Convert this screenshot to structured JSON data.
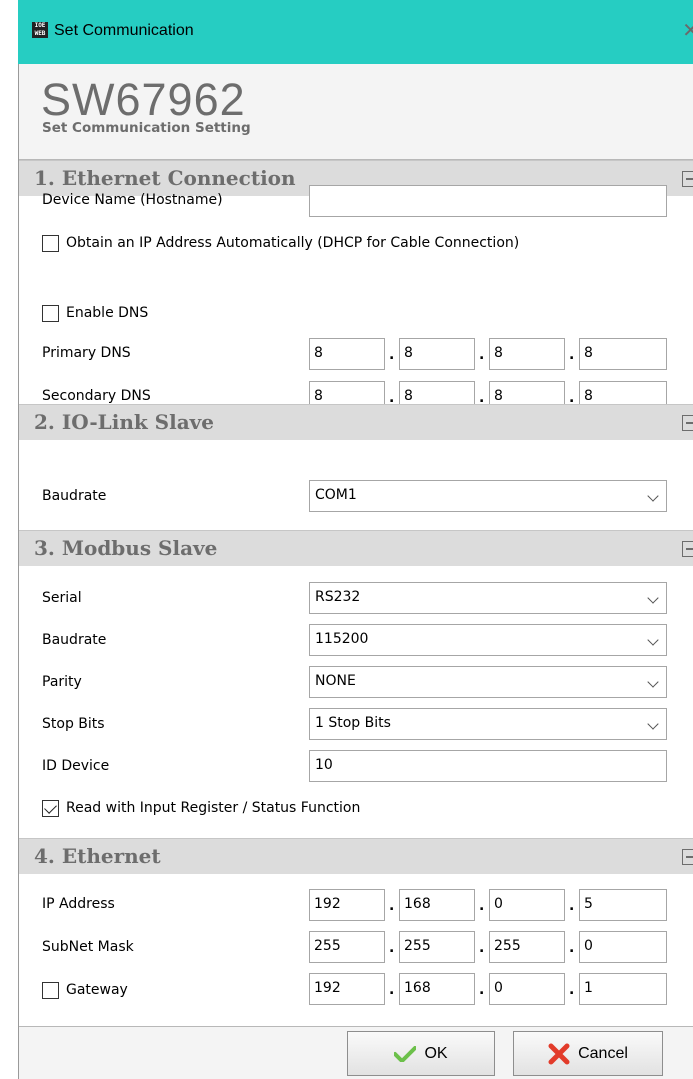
{
  "window": {
    "title": "Set Communication",
    "icon": "app-web-icon"
  },
  "header": {
    "code": "SW67962",
    "subtitle": "Set Communication Setting"
  },
  "ethernet_connection": {
    "title": "1. Ethernet Connection",
    "device_name_label": "Device Name (Hostname)",
    "device_name_value": "",
    "dhcp_label": "Obtain an IP Address Automatically (DHCP for Cable Connection)",
    "dhcp_checked": false,
    "dns_label": "Enable DNS",
    "dns_checked": false,
    "primary_dns_label": "Primary DNS",
    "primary_dns": [
      "8",
      "8",
      "8",
      "8"
    ],
    "secondary_dns_label": "Secondary DNS",
    "secondary_dns": [
      "8",
      "8",
      "8",
      "8"
    ]
  },
  "io_link": {
    "title": "2. IO-Link Slave",
    "baudrate_label": "Baudrate",
    "baudrate_value": "COM1"
  },
  "modbus": {
    "title": "3. Modbus Slave",
    "serial_label": "Serial",
    "serial_value": "RS232",
    "baudrate_label": "Baudrate",
    "baudrate_value": "115200",
    "parity_label": "Parity",
    "parity_value": "NONE",
    "stopbits_label": "Stop Bits",
    "stopbits_value": "1 Stop Bits",
    "id_label": "ID Device",
    "id_value": "10",
    "read_input_label": "Read with Input Register / Status Function",
    "read_input_checked": true
  },
  "ethernet": {
    "title": "4. Ethernet",
    "ip_label": "IP Address",
    "ip": [
      "192",
      "168",
      "0",
      "5"
    ],
    "mask_label": "SubNet Mask",
    "mask": [
      "255",
      "255",
      "255",
      "0"
    ],
    "gateway_label": "Gateway",
    "gateway_checked": false,
    "gateway": [
      "192",
      "168",
      "0",
      "1"
    ]
  },
  "footer": {
    "ok_label": "OK",
    "cancel_label": "Cancel"
  },
  "colors": {
    "titlebar": "#26cdc2",
    "section_bg": "#dcdcdc",
    "section_text": "#6d6d6d"
  }
}
